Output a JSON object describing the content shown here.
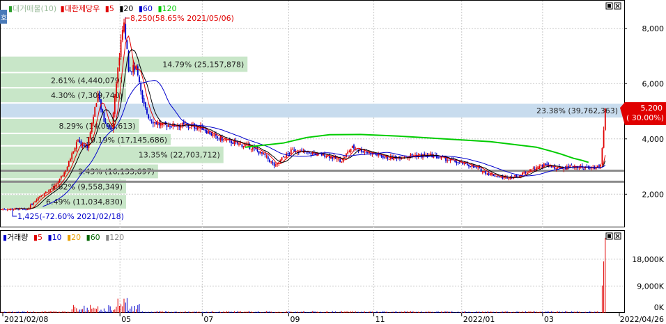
{
  "price_legend": {
    "volume_profile_label": "대거매물(10)",
    "name": "대한제당우",
    "ma_labels": [
      {
        "text": "5",
        "color": "#e00000"
      },
      {
        "text": "20",
        "color": "#000000"
      },
      {
        "text": "60",
        "color": "#0000cc"
      },
      {
        "text": "120",
        "color": "#00cc00"
      }
    ]
  },
  "volume_legend": {
    "name": "거래량",
    "ma_labels": [
      {
        "text": "5",
        "color": "#e00000"
      },
      {
        "text": "10",
        "color": "#0000cc"
      },
      {
        "text": "20",
        "color": "#e8a000"
      },
      {
        "text": "60",
        "color": "#006600"
      },
      {
        "text": "120",
        "color": "#888888"
      }
    ]
  },
  "annotations": {
    "high": "8,250(58.65% 2021/05/06)",
    "low": "1,425(-72.60% 2021/02/18)"
  },
  "current_price": {
    "price": "5,200",
    "change": "( 30.00%)"
  },
  "colors": {
    "up": "#e00000",
    "down": "#0000cc",
    "profile": "#c8e6c8",
    "profile_highlight": "#c8dcee",
    "ma5": "#e00000",
    "ma20": "#000000",
    "ma60": "#0000cc",
    "ma120": "#00cc00"
  },
  "chart_data": [
    {
      "type": "candlestick",
      "title": "대한제당우",
      "y_ticks": [
        "8,000",
        "6,000",
        "4,000",
        "2,000"
      ],
      "y_tick_values": [
        8000,
        6000,
        4000,
        2000
      ],
      "ylim": [
        800,
        9000
      ],
      "x_ticks": [
        "2021/02/08",
        "05",
        "07",
        "09",
        "11",
        "2022/01",
        "03",
        "2022/04/26"
      ],
      "x_tick_dates": [
        "2021-02-08",
        "2021-05-03",
        "2021-07-01",
        "2021-09-01",
        "2021-11-01",
        "2022-01-03",
        "2022-03-02",
        "2022-04-26"
      ],
      "series": [
        {
          "name": "5",
          "type": "ma"
        },
        {
          "name": "20",
          "type": "ma"
        },
        {
          "name": "60",
          "type": "ma"
        },
        {
          "name": "120",
          "type": "ma"
        }
      ],
      "volume_profile": [
        {
          "label": "14.79% (25,157,878)",
          "low": 6400,
          "high": 7000
        },
        {
          "label": "2.61% (4,440,079)",
          "low": 5850,
          "high": 6400
        },
        {
          "label": "4.30% (7,309,740)",
          "low": 5300,
          "high": 5850
        },
        {
          "label": "23.38% (39,762,363)",
          "low": 4750,
          "high": 5300,
          "highlight": true
        },
        {
          "label": "8.29% (14,098,613)",
          "low": 4200,
          "high": 4750
        },
        {
          "label": "10.19% (17,145,686)",
          "low": 3750,
          "high": 4200
        },
        {
          "label": "13.35% (22,703,712)",
          "low": 3100,
          "high": 3750
        },
        {
          "label": "9.43% (16,133,697)",
          "low": 2550,
          "high": 3100
        },
        {
          "label": "5.62% (9,558,349)",
          "low": 2000,
          "high": 2550
        },
        {
          "label": "6.49% (11,034,830)",
          "low": 1450,
          "high": 2000
        }
      ],
      "key_levels": [
        2850,
        2450
      ],
      "ma120": [
        [
          160,
          3700
        ],
        [
          185,
          3850
        ],
        [
          200,
          4050
        ],
        [
          215,
          4150
        ],
        [
          235,
          4160
        ],
        [
          260,
          4100
        ],
        [
          290,
          4000
        ],
        [
          320,
          3900
        ],
        [
          350,
          3700
        ],
        [
          360,
          3550
        ],
        [
          366,
          3450
        ],
        [
          374,
          3300
        ],
        [
          380,
          3220
        ],
        [
          384,
          3150
        ]
      ],
      "candles_note": "price path approximated from chart"
    },
    {
      "type": "bar",
      "title": "거래량",
      "y_ticks": [
        "18,000K",
        "9,000K",
        "0K"
      ],
      "y_tick_values": [
        18000,
        9000,
        0
      ],
      "ylim": [
        0,
        27500
      ],
      "series": [
        {
          "name": "5"
        },
        {
          "name": "10"
        },
        {
          "name": "20"
        },
        {
          "name": "60"
        },
        {
          "name": "120"
        }
      ]
    }
  ]
}
